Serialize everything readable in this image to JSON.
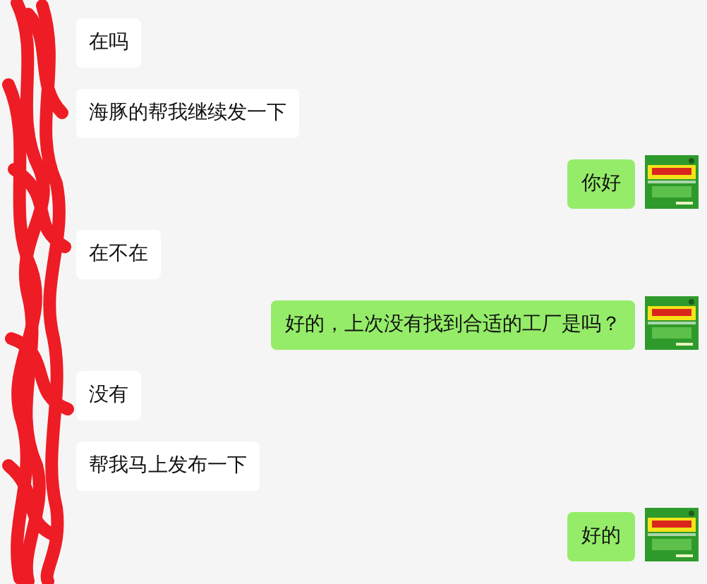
{
  "messages": [
    {
      "kind": "incoming",
      "text": "在吗"
    },
    {
      "kind": "incoming",
      "text": "海豚的帮我继续发一下"
    },
    {
      "kind": "outgoing",
      "text": "你好"
    },
    {
      "kind": "incoming",
      "text": "在不在"
    },
    {
      "kind": "outgoing",
      "text": "好的，上次没有找到合适的工厂是吗？"
    },
    {
      "kind": "incoming",
      "text": "没有"
    },
    {
      "kind": "incoming",
      "text": "帮我马上发布一下"
    },
    {
      "kind": "outgoing",
      "text": "好的"
    }
  ]
}
